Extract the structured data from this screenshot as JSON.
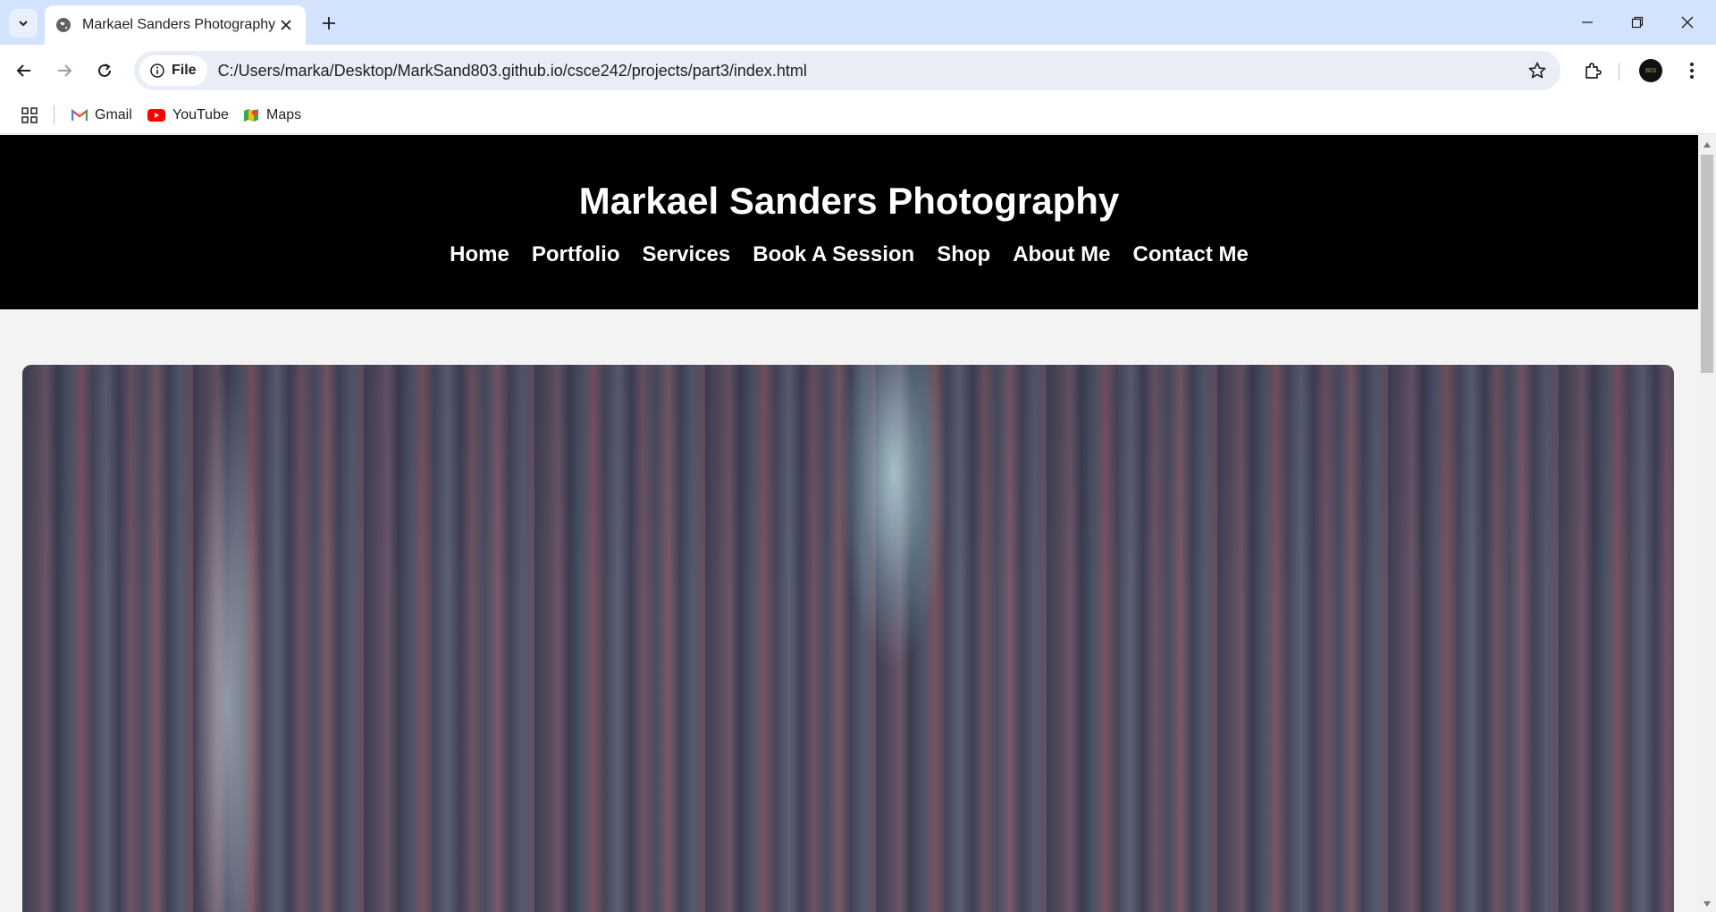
{
  "browser": {
    "tab": {
      "title": "Markael Sanders Photography",
      "icon": "globe-icon"
    },
    "address": {
      "chip_label": "File",
      "url": "C:/Users/marka/Desktop/MarkSand803.github.io/csce242/projects/part3/index.html"
    },
    "profile_initials": "803",
    "bookmarks": [
      {
        "label": "Gmail",
        "icon": "gmail-icon"
      },
      {
        "label": "YouTube",
        "icon": "youtube-icon"
      },
      {
        "label": "Maps",
        "icon": "maps-icon"
      }
    ]
  },
  "site": {
    "title": "Markael Sanders Photography",
    "nav": [
      "Home",
      "Portfolio",
      "Services",
      "Book A Session",
      "Shop",
      "About Me",
      "Contact Me"
    ],
    "hero_image": "forest-photo",
    "colors": {
      "header_bg": "#000000",
      "header_text": "#ffffff",
      "page_bg": "#f3f3f3"
    }
  }
}
